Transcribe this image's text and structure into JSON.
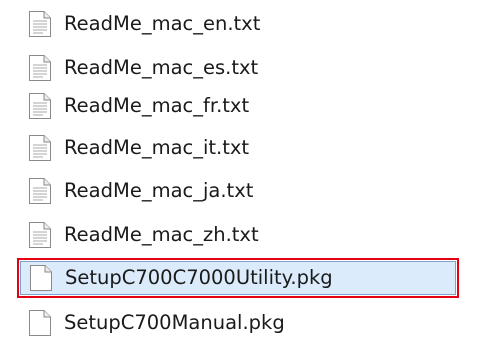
{
  "files": [
    {
      "name": "ReadMe_mac_en.txt",
      "icon": "text-document-icon",
      "selected": false
    },
    {
      "name": "ReadMe_mac_es.txt",
      "icon": "text-document-icon",
      "selected": false
    },
    {
      "name": "ReadMe_mac_fr.txt",
      "icon": "text-document-icon",
      "selected": false
    },
    {
      "name": "ReadMe_mac_it.txt",
      "icon": "text-document-icon",
      "selected": false
    },
    {
      "name": "ReadMe_mac_ja.txt",
      "icon": "text-document-icon",
      "selected": false
    },
    {
      "name": "ReadMe_mac_zh.txt",
      "icon": "text-document-icon",
      "selected": false
    },
    {
      "name": "SetupC700C7000Utility.pkg",
      "icon": "blank-document-icon",
      "selected": true
    },
    {
      "name": "SetupC700Manual.pkg",
      "icon": "blank-document-icon",
      "selected": false
    }
  ],
  "colors": {
    "selection_fill": "#dcebfc",
    "selection_border": "#7da2ce",
    "highlight_outline": "#e60012",
    "text": "#1a1a1a"
  }
}
